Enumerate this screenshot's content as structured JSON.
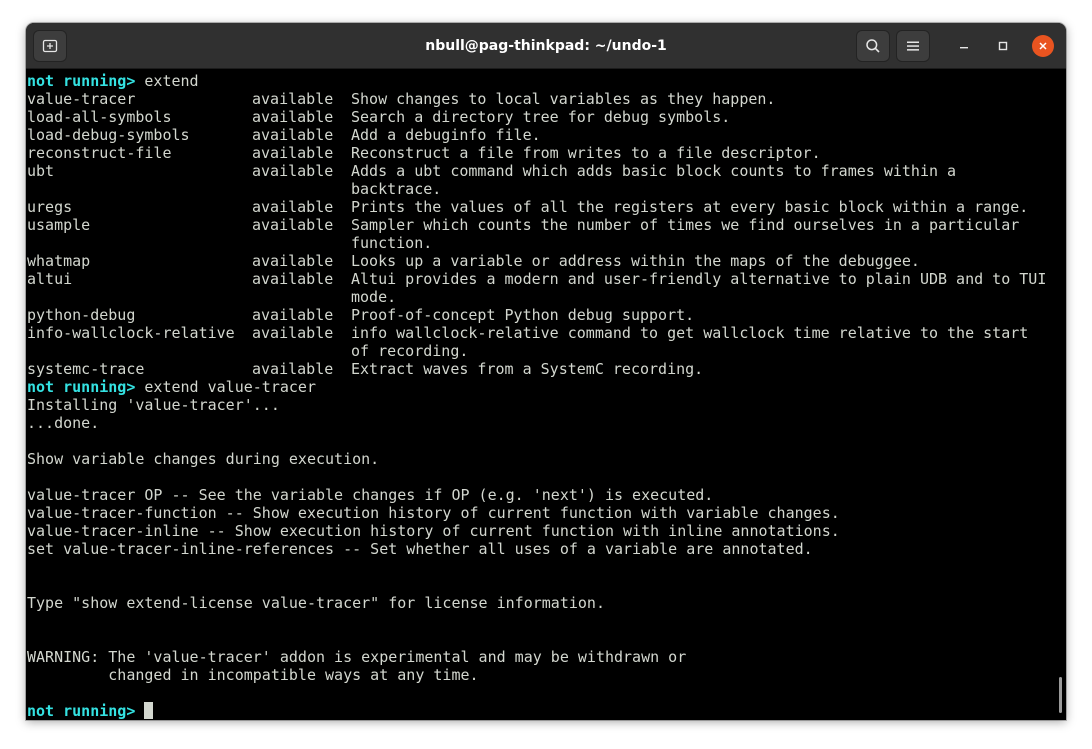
{
  "window": {
    "title": "nbull@pag-thinkpad: ~/undo-1",
    "icons": {
      "new_tab": "new-tab-icon",
      "search": "search-icon",
      "menu": "hamburger-menu-icon",
      "minimize": "minimize-icon",
      "maximize": "maximize-icon",
      "close": "close-icon"
    },
    "colors": {
      "titlebar": "#303030",
      "close": "#e95420",
      "prompt": "#34e2e2",
      "text": "#d3d7cf",
      "background": "#000000"
    }
  },
  "terminal": {
    "prompt": "not running>",
    "cmd1": " extend",
    "extensions": [
      {
        "name": "value-tracer",
        "status": "available",
        "desc": "Show changes to local variables as they happen."
      },
      {
        "name": "load-all-symbols",
        "status": "available",
        "desc": "Search a directory tree for debug symbols."
      },
      {
        "name": "load-debug-symbols",
        "status": "available",
        "desc": "Add a debuginfo file."
      },
      {
        "name": "reconstruct-file",
        "status": "available",
        "desc": "Reconstruct a file from writes to a file descriptor."
      },
      {
        "name": "ubt",
        "status": "available",
        "desc": "Adds a ubt command which adds basic block counts to frames within a",
        "desc2": "backtrace."
      },
      {
        "name": "uregs",
        "status": "available",
        "desc": "Prints the values of all the registers at every basic block within a range."
      },
      {
        "name": "usample",
        "status": "available",
        "desc": "Sampler which counts the number of times we find ourselves in a particular",
        "desc2": "function."
      },
      {
        "name": "whatmap",
        "status": "available",
        "desc": "Looks up a variable or address within the maps of the debuggee."
      },
      {
        "name": "altui",
        "status": "available",
        "desc": "Altui provides a modern and user-friendly alternative to plain UDB and to TUI",
        "desc2": "mode."
      },
      {
        "name": "python-debug",
        "status": "available",
        "desc": "Proof-of-concept Python debug support."
      },
      {
        "name": "info-wallclock-relative",
        "status": "available",
        "desc": "info wallclock-relative command to get wallclock time relative to the start",
        "desc2": "of recording."
      },
      {
        "name": "systemc-trace",
        "status": "available",
        "desc": "Extract waves from a SystemC recording."
      }
    ],
    "cmd2": " extend value-tracer",
    "installing": "Installing 'value-tracer'...",
    "done": "...done.",
    "summary": "Show variable changes during execution.",
    "help": [
      "value-tracer OP -- See the variable changes if OP (e.g. 'next') is executed.",
      "value-tracer-function -- Show execution history of current function with variable changes.",
      "value-tracer-inline -- Show execution history of current function with inline annotations.",
      "set value-tracer-inline-references -- Set whether all uses of a variable are annotated."
    ],
    "license": "Type \"show extend-license value-tracer\" for license information.",
    "warning1": "WARNING: The 'value-tracer' addon is experimental and may be withdrawn or",
    "warning2": "         changed in incompatible ways at any time."
  }
}
